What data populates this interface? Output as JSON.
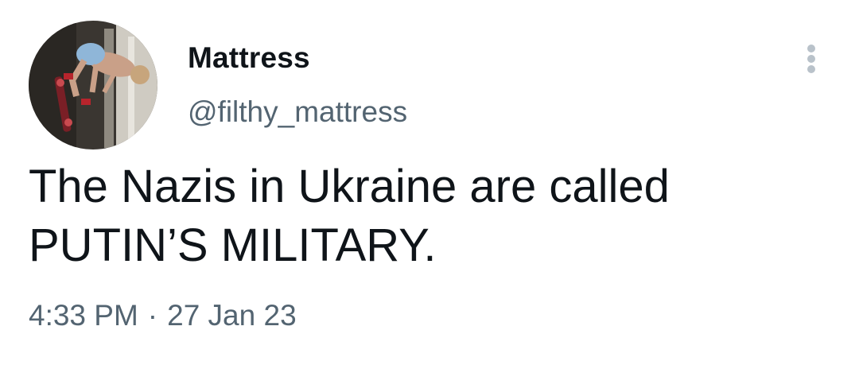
{
  "author": {
    "display_name": "Mattress",
    "handle": "@filthy_mattress"
  },
  "tweet": {
    "text": "The Nazis in Ukraine are called\nPUTIN’S MILITARY.",
    "time": "4:33 PM",
    "separator": "·",
    "date": "27 Jan 23"
  },
  "icons": {
    "avatar": "avatar-photo-skateboarder",
    "menu": "more-options-icon"
  },
  "colors": {
    "text_primary": "#0f1419",
    "text_secondary": "#536471",
    "menu_dots": "#b9c2ca",
    "background": "#ffffff"
  }
}
